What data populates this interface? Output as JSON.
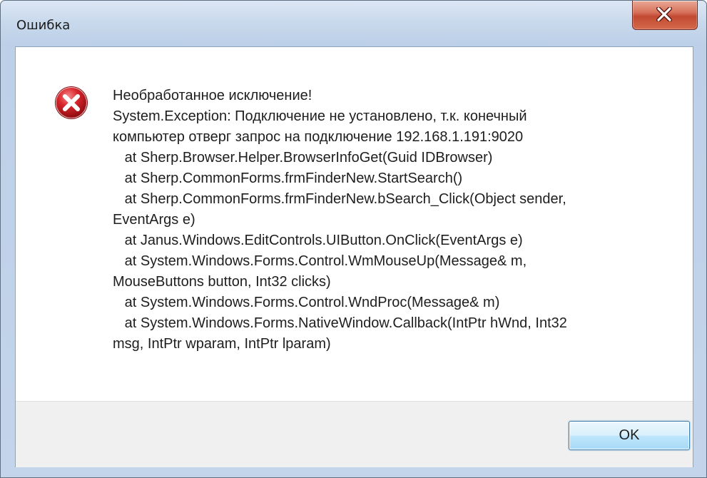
{
  "window": {
    "title": "Ошибка"
  },
  "message": {
    "lines": [
      "Необработанное исключение!",
      "System.Exception: Подключение не установлено, т.к. конечный",
      "компьютер отверг запрос на подключение 192.168.1.191:9020",
      "   at Sherp.Browser.Helper.BrowserInfoGet(Guid IDBrowser)",
      "   at Sherp.CommonForms.frmFinderNew.StartSearch()",
      "   at Sherp.CommonForms.frmFinderNew.bSearch_Click(Object sender,",
      "EventArgs e)",
      "   at Janus.Windows.EditControls.UIButton.OnClick(EventArgs e)",
      "   at System.Windows.Forms.Control.WmMouseUp(Message& m,",
      "MouseButtons button, Int32 clicks)",
      "   at System.Windows.Forms.Control.WndProc(Message& m)",
      "   at System.Windows.Forms.NativeWindow.Callback(IntPtr hWnd, Int32",
      "msg, IntPtr wparam, IntPtr lparam)"
    ]
  },
  "buttons": {
    "ok_label": "OK"
  },
  "icons": {
    "error": "error-x-icon",
    "close": "close-icon"
  },
  "colors": {
    "error_red": "#c8141c",
    "close_button_red": "#c24a32",
    "ok_button_border": "#3c7fb1"
  }
}
